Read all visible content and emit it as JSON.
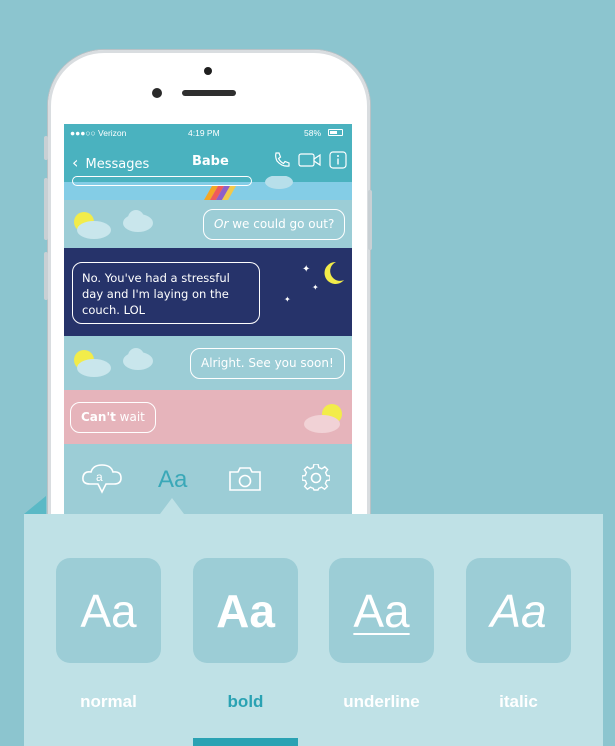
{
  "status": {
    "carrier": "●●●○○ Verizon",
    "time": "4:19 PM",
    "battery": "58%"
  },
  "nav": {
    "back_label": "Messages",
    "title": "Babe"
  },
  "messages": [
    {
      "text_emphasis": "Or",
      "text_rest": " we could go out?",
      "side": "right"
    },
    {
      "text": "No. You've had a stressful day and I'm laying on the couch. LOL",
      "line1": "No. You've had a stressful",
      "line2": "day and I'm laying on the",
      "line3": "couch. LOL",
      "side": "left"
    },
    {
      "text": "Alright. See you soon!",
      "side": "right"
    },
    {
      "text_bold": "Can't",
      "text_rest": " wait",
      "side": "left"
    }
  ],
  "toolbar": {
    "aa_label": "Aa",
    "items": [
      "sticker-icon",
      "text-style-icon",
      "camera-icon",
      "gear-icon"
    ]
  },
  "styles": [
    {
      "sample": "Aa",
      "label": "normal"
    },
    {
      "sample": "Aa",
      "label": "bold"
    },
    {
      "sample": "Aa",
      "label": "underline"
    },
    {
      "sample": "Aa",
      "label": "italic"
    }
  ],
  "selected_style": "bold",
  "colors": {
    "background": "#8cc5cf",
    "accent": "#4ab2bf",
    "night": "#26336a",
    "pink": "#e6b4bb",
    "panel": "#bfe1e6",
    "selected_label": "#2aa2b3"
  }
}
